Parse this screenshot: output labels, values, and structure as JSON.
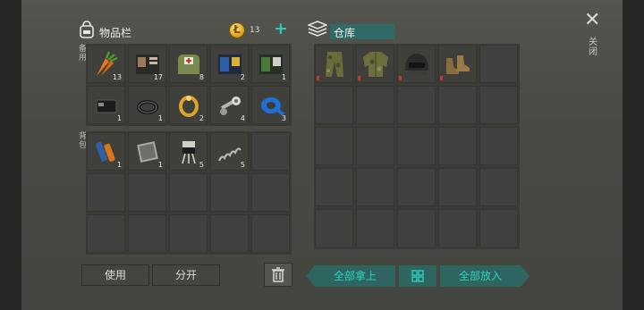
{
  "inventory": {
    "title": "物品栏",
    "coins": "13",
    "add_symbol": "+",
    "section_equip": "备用",
    "section_backpack": "背包",
    "equip_slots": [
      {
        "icon": "carrot-icon",
        "count": "13"
      },
      {
        "icon": "book-icon",
        "count": "17"
      },
      {
        "icon": "first-aid-pouch-icon",
        "count": "8"
      },
      {
        "icon": "blue-book-icon",
        "count": "2"
      },
      {
        "icon": "green-book-icon",
        "count": "1"
      },
      {
        "icon": "wallet-icon",
        "count": "1"
      },
      {
        "icon": "rubber-ring-icon",
        "count": "1"
      },
      {
        "icon": "gold-ring-icon",
        "count": "2"
      },
      {
        "icon": "bolt-nut-icon",
        "count": "4"
      },
      {
        "icon": "blue-tape-icon",
        "count": "3"
      }
    ],
    "backpack_slots": [
      {
        "icon": "batteries-icon",
        "count": "1"
      },
      {
        "icon": "metal-plate-icon",
        "count": "1"
      },
      {
        "icon": "transistor-icon",
        "count": "5"
      },
      {
        "icon": "spring-icon",
        "count": "5"
      }
    ]
  },
  "warehouse": {
    "title": "仓库",
    "items": [
      {
        "icon": "camo-pants-icon"
      },
      {
        "icon": "camo-jacket-icon"
      },
      {
        "icon": "combat-helmet-icon"
      },
      {
        "icon": "boots-icon"
      }
    ]
  },
  "close_label": "关闭",
  "buttons": {
    "use": "使用",
    "split": "分开",
    "take_all": "全部拿上",
    "put_all": "全部放入"
  },
  "colors": {
    "accent": "#2ec9b5",
    "durability_marker": "#c23a2a"
  }
}
